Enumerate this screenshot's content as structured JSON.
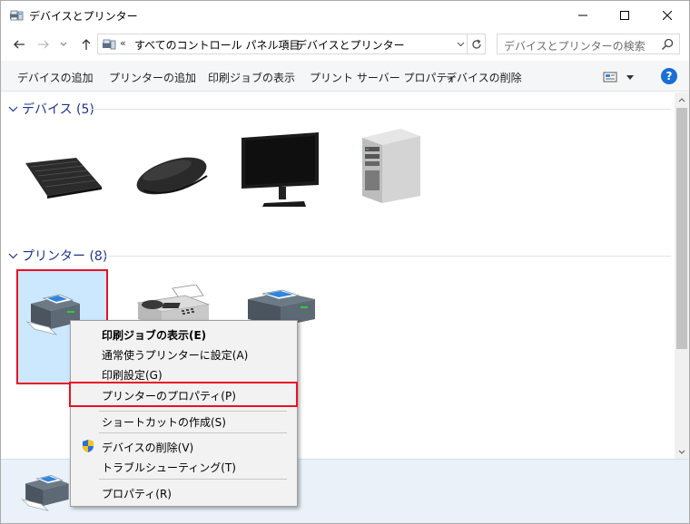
{
  "window": {
    "title": "デバイスとプリンター",
    "controls": {
      "minimize": "minimize",
      "maximize": "maximize",
      "close": "close"
    }
  },
  "address_bar": {
    "overflow": "«",
    "segments": [
      "すべてのコントロール パネル項目",
      "デバイスとプリンター"
    ],
    "separator": "›"
  },
  "search": {
    "placeholder": "デバイスとプリンターの検索"
  },
  "commands": {
    "add_device": "デバイスの追加",
    "add_printer": "プリンターの追加",
    "show_print_jobs": "印刷ジョブの表示",
    "print_server_properties": "プリント サーバー プロパティ",
    "remove_device": "デバイスの削除"
  },
  "help": {
    "glyph": "?"
  },
  "groups": {
    "devices": {
      "title": "デバイス (5)"
    },
    "printers": {
      "title": "プリンター (8)"
    }
  },
  "devices": [
    {
      "icon": "keyboard-icon"
    },
    {
      "icon": "mouse-icon"
    },
    {
      "icon": "monitor-icon"
    },
    {
      "icon": "computer-tower-icon"
    }
  ],
  "printers": [
    {
      "icon": "printer-icon",
      "selected": true
    },
    {
      "icon": "fax-icon",
      "selected": false
    },
    {
      "icon": "printer-icon",
      "selected": false
    }
  ],
  "context_menu": {
    "items": [
      {
        "label": "印刷ジョブの表示(E)",
        "bold": true
      },
      {
        "label": "通常使うプリンターに設定(A)",
        "bold": false
      },
      {
        "label": "印刷設定(G)",
        "bold": false
      },
      {
        "label": "プリンターのプロパティ(P)",
        "bold": false,
        "highlighted": true
      },
      {
        "label": "ショートカットの作成(S)",
        "bold": false
      },
      {
        "label": "デバイスの削除(V)",
        "bold": false,
        "icon": "uac-shield-icon"
      },
      {
        "label": "トラブルシューティング(T)",
        "bold": false
      },
      {
        "label": "プロパティ(R)",
        "bold": false
      }
    ]
  },
  "colors": {
    "accent": "#1a6fd1",
    "selection": "#cce8ff",
    "highlight_border": "#e81123",
    "group_title": "#1e3287"
  }
}
